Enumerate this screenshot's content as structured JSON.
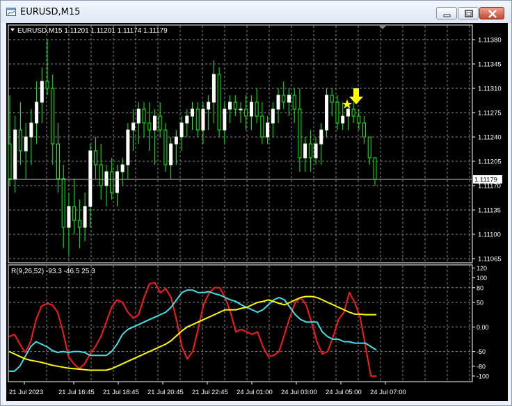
{
  "window": {
    "title": "EURUSD,M15"
  },
  "price_pane": {
    "header": "EURUSD,M15  1.11201 1.11201 1.11174 1.11179",
    "current_price_label": "1.11179",
    "y_ticks": [
      "1.11380",
      "1.11345",
      "1.11310",
      "1.11275",
      "1.11240",
      "1.11205",
      "1.11170",
      "1.11135",
      "1.11100",
      "1.11065"
    ]
  },
  "indicator_pane": {
    "header": "R(9,26,52) -93.3 -46.5 25.3",
    "y_ticks": [
      "120",
      "100",
      "80",
      "50",
      "0.00",
      "-50",
      "-80",
      "-100"
    ]
  },
  "time_axis": {
    "labels": [
      "21 Jul 2023",
      "21 Jul 16:45",
      "21 Jul 18:45",
      "21 Jul 20:45",
      "21 Jul 22:45",
      "24 Jul 01:00",
      "24 Jul 03:00",
      "24 Jul 05:00",
      "24 Jul 07:00"
    ]
  },
  "colors": {
    "background": "#000000",
    "candle_bull": "#ffffff",
    "candle_bear": "#00ff00",
    "grid": "#c0c0c0",
    "ind_red": "#ff1a1a",
    "ind_cyan": "#40e0e8",
    "ind_yellow": "#ffff00",
    "signal_arrow": "#ffff00"
  },
  "signal": {
    "icons": [
      "sell-arrow-icon",
      "star-icon"
    ]
  },
  "chart_data": [
    {
      "type": "candlestick",
      "title": "EURUSD,M15",
      "ohlc_header": [
        1.11201,
        1.11201,
        1.11174,
        1.11179
      ],
      "ylim": [
        1.1106,
        1.114
      ],
      "current_price": 1.11179,
      "candles": [
        [
          1.1123,
          1.113,
          1.1117,
          1.1118
        ],
        [
          1.1118,
          1.1127,
          1.1116,
          1.1125
        ],
        [
          1.1125,
          1.1129,
          1.112,
          1.1122
        ],
        [
          1.1122,
          1.1126,
          1.1118,
          1.1124
        ],
        [
          1.1124,
          1.1128,
          1.112,
          1.1126
        ],
        [
          1.1126,
          1.1132,
          1.1123,
          1.1129
        ],
        [
          1.1129,
          1.1134,
          1.1126,
          1.1132
        ],
        [
          1.1132,
          1.1138,
          1.113,
          1.1131
        ],
        [
          1.1131,
          1.1133,
          1.112,
          1.1123
        ],
        [
          1.1123,
          1.1126,
          1.1116,
          1.1118
        ],
        [
          1.1118,
          1.112,
          1.1108,
          1.1111
        ],
        [
          1.1111,
          1.1116,
          1.1107,
          1.1114
        ],
        [
          1.1114,
          1.1118,
          1.111,
          1.1112
        ],
        [
          1.1112,
          1.1115,
          1.1108,
          1.1111
        ],
        [
          1.1111,
          1.1116,
          1.1109,
          1.1114
        ],
        [
          1.1114,
          1.1123,
          1.1111,
          1.1122
        ],
        [
          1.1122,
          1.1124,
          1.1118,
          1.112
        ],
        [
          1.112,
          1.1123,
          1.1115,
          1.1117
        ],
        [
          1.1117,
          1.112,
          1.1114,
          1.1119
        ],
        [
          1.1119,
          1.1121,
          1.1115,
          1.1116
        ],
        [
          1.1116,
          1.112,
          1.1114,
          1.1119
        ],
        [
          1.1119,
          1.1121,
          1.1117,
          1.112
        ],
        [
          1.112,
          1.1126,
          1.1118,
          1.1125
        ],
        [
          1.1125,
          1.1128,
          1.1122,
          1.1126
        ],
        [
          1.1126,
          1.1129,
          1.1123,
          1.1128
        ],
        [
          1.1128,
          1.1129,
          1.1124,
          1.1126
        ],
        [
          1.1126,
          1.1129,
          1.1122,
          1.1125
        ],
        [
          1.1125,
          1.1128,
          1.112,
          1.1127
        ],
        [
          1.1127,
          1.1129,
          1.1124,
          1.1125
        ],
        [
          1.1125,
          1.1126,
          1.1119,
          1.112
        ],
        [
          1.112,
          1.1124,
          1.1118,
          1.1123
        ],
        [
          1.1123,
          1.1125,
          1.112,
          1.1124
        ],
        [
          1.1124,
          1.1127,
          1.1122,
          1.1126
        ],
        [
          1.1126,
          1.1128,
          1.1124,
          1.1127
        ],
        [
          1.1127,
          1.1129,
          1.1125,
          1.1128
        ],
        [
          1.1128,
          1.1129,
          1.1124,
          1.1125
        ],
        [
          1.1125,
          1.1129,
          1.1123,
          1.1128
        ],
        [
          1.1128,
          1.113,
          1.1125,
          1.1129
        ],
        [
          1.1129,
          1.1135,
          1.1126,
          1.1133
        ],
        [
          1.1133,
          1.1134,
          1.1124,
          1.1125
        ],
        [
          1.1125,
          1.1129,
          1.1123,
          1.1128
        ],
        [
          1.1128,
          1.113,
          1.1126,
          1.1129
        ],
        [
          1.1129,
          1.113,
          1.1127,
          1.1128
        ],
        [
          1.1128,
          1.1129,
          1.1126,
          1.1128
        ],
        [
          1.1128,
          1.113,
          1.1125,
          1.1127
        ],
        [
          1.1127,
          1.113,
          1.1125,
          1.1129
        ],
        [
          1.1129,
          1.1131,
          1.1126,
          1.1127
        ],
        [
          1.1127,
          1.1129,
          1.1123,
          1.1124
        ],
        [
          1.1124,
          1.1127,
          1.1123,
          1.1126
        ],
        [
          1.1126,
          1.1129,
          1.1124,
          1.1128
        ],
        [
          1.1128,
          1.1131,
          1.1126,
          1.113
        ],
        [
          1.113,
          1.1132,
          1.1128,
          1.1129
        ],
        [
          1.1129,
          1.1131,
          1.1127,
          1.113
        ],
        [
          1.113,
          1.1131,
          1.1126,
          1.1128
        ],
        [
          1.1128,
          1.1131,
          1.1119,
          1.1121
        ],
        [
          1.1121,
          1.1124,
          1.1119,
          1.1123
        ],
        [
          1.1123,
          1.1125,
          1.1119,
          1.1121
        ],
        [
          1.1121,
          1.1124,
          1.112,
          1.1123
        ],
        [
          1.1123,
          1.1126,
          1.112,
          1.1125
        ],
        [
          1.1125,
          1.1131,
          1.1124,
          1.113
        ],
        [
          1.113,
          1.1131,
          1.1127,
          1.1129
        ],
        [
          1.1129,
          1.113,
          1.1125,
          1.1126
        ],
        [
          1.1126,
          1.1129,
          1.1125,
          1.1127
        ],
        [
          1.1127,
          1.1129,
          1.1125,
          1.1128
        ],
        [
          1.1128,
          1.1129,
          1.1126,
          1.1127
        ],
        [
          1.1127,
          1.1128,
          1.1125,
          1.1126
        ],
        [
          1.1126,
          1.1127,
          1.1123,
          1.1124
        ],
        [
          1.1124,
          1.1124,
          1.112,
          1.1121
        ],
        [
          1.1121,
          1.1121,
          1.1117,
          1.11179
        ]
      ]
    },
    {
      "type": "line",
      "title": "R(9,26,52)",
      "ylim": [
        -110,
        125
      ],
      "series": [
        {
          "name": "R(9)",
          "values": [
            -20,
            -15,
            -35,
            -52,
            -30,
            15,
            42,
            48,
            45,
            30,
            -10,
            -60,
            -75,
            -85,
            -75,
            -55,
            -40,
            -20,
            10,
            40,
            55,
            50,
            30,
            18,
            25,
            60,
            88,
            90,
            70,
            78,
            60,
            15,
            -40,
            -65,
            -50,
            -5,
            45,
            68,
            80,
            80,
            60,
            30,
            -10,
            -5,
            -10,
            -15,
            -10,
            -40,
            -60,
            -58,
            -50,
            -15,
            20,
            50,
            60,
            45,
            10,
            -30,
            -55,
            -50,
            -20,
            15,
            30,
            70,
            50,
            20,
            -40,
            -100,
            -100
          ]
        },
        {
          "name": "R(26)",
          "values": [
            -90,
            -90,
            -80,
            -60,
            -40,
            -30,
            -35,
            -40,
            -48,
            -52,
            -50,
            -52,
            -50,
            -50,
            -52,
            -58,
            -58,
            -58,
            -58,
            -50,
            -35,
            -15,
            -5,
            0,
            5,
            10,
            15,
            20,
            25,
            30,
            40,
            55,
            70,
            75,
            75,
            70,
            70,
            72,
            68,
            65,
            60,
            55,
            52,
            45,
            40,
            35,
            30,
            35,
            45,
            55,
            60,
            55,
            40,
            25,
            15,
            10,
            10,
            10,
            -10,
            -20,
            -25,
            -25,
            -30,
            -30,
            -33,
            -33,
            -33,
            -40,
            -47
          ]
        },
        {
          "name": "R(52)",
          "values": [
            -50,
            -55,
            -60,
            -65,
            -68,
            -70,
            -72,
            -75,
            -78,
            -80,
            -82,
            -84,
            -85,
            -86,
            -87,
            -88,
            -88,
            -88,
            -88,
            -85,
            -80,
            -75,
            -70,
            -65,
            -60,
            -55,
            -50,
            -45,
            -40,
            -35,
            -28,
            -18,
            -8,
            0,
            5,
            10,
            15,
            20,
            25,
            30,
            35,
            35,
            35,
            38,
            40,
            45,
            50,
            52,
            55,
            52,
            48,
            45,
            50,
            55,
            60,
            62,
            62,
            60,
            55,
            50,
            45,
            40,
            35,
            30,
            26,
            26,
            25,
            25,
            25
          ]
        }
      ]
    }
  ]
}
